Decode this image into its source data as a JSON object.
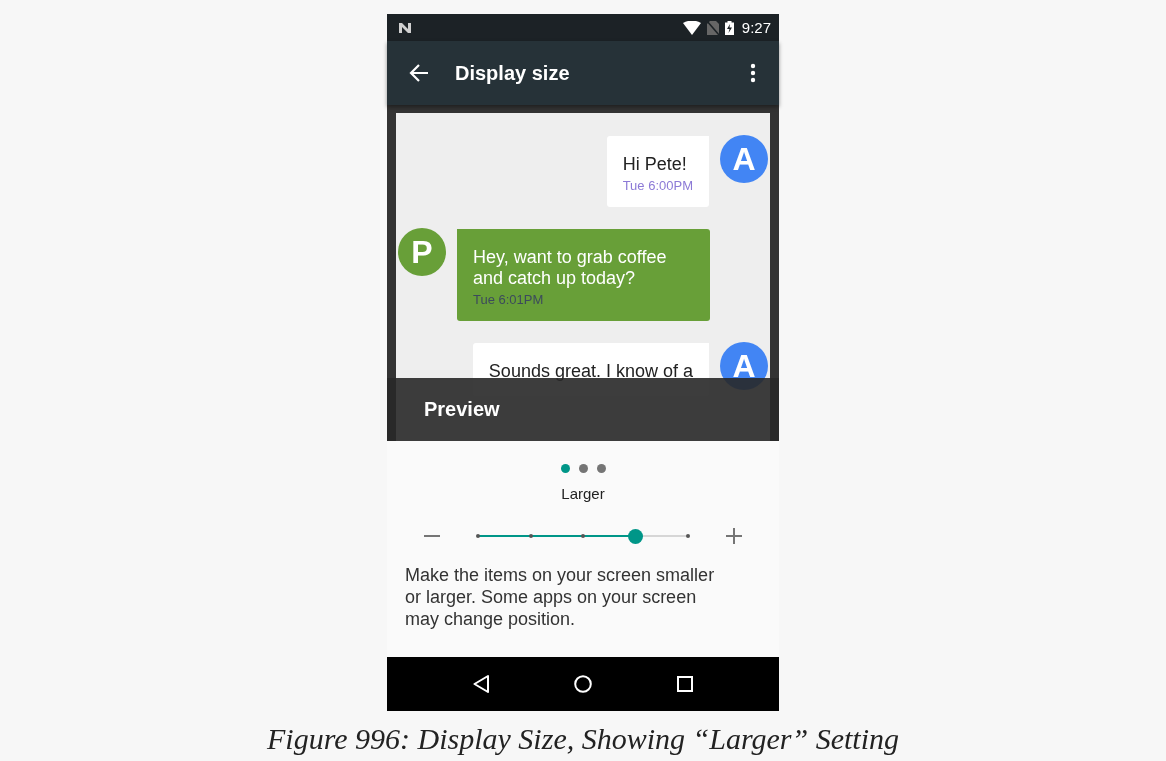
{
  "status_bar": {
    "time": "9:27"
  },
  "toolbar": {
    "title": "Display size"
  },
  "preview": {
    "label": "Preview",
    "messages": [
      {
        "kind": "received",
        "avatar": "A",
        "color": "#4285f4",
        "text": "Hi Pete!",
        "time": "Tue 6:00PM"
      },
      {
        "kind": "sent",
        "avatar": "P",
        "color": "#689f38",
        "text": "Hey, want to grab coffee and catch up today?",
        "time": "Tue 6:01PM"
      },
      {
        "kind": "received",
        "avatar": "A",
        "color": "#4285f4",
        "text": "Sounds great. I know of a"
      }
    ]
  },
  "pager_dots": [
    {
      "selected": true
    },
    {
      "selected": false
    },
    {
      "selected": false
    }
  ],
  "size": {
    "label": "Larger",
    "level": 0.75
  },
  "description": "Make the items on your screen smaller or larger. Some apps on your screen may change position.",
  "caption": "Figure 996: Display Size, Showing “Larger” Setting"
}
